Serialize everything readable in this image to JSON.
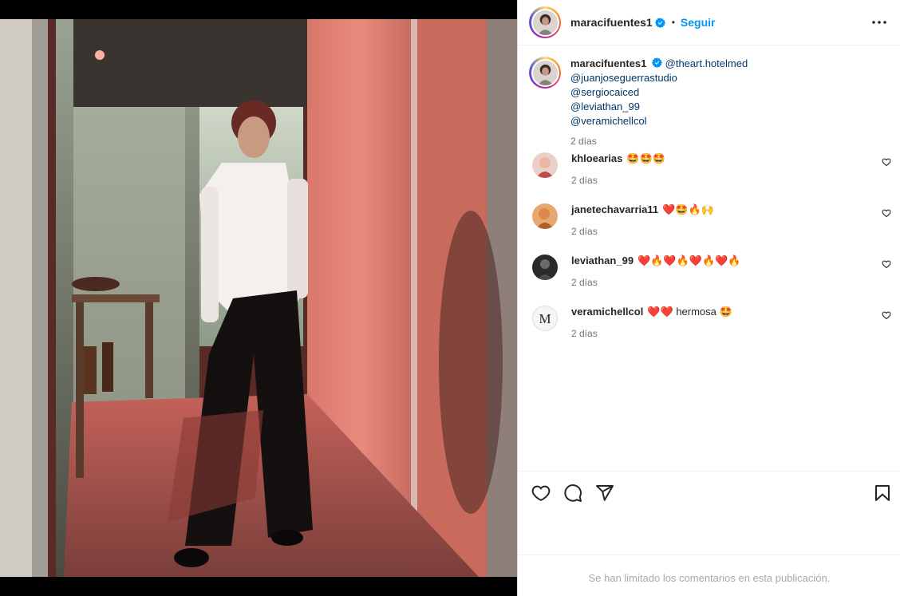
{
  "post": {
    "author": "maracifuentes1",
    "verified": true,
    "separator": "•",
    "follow_label": "Seguir",
    "more_icon": "more-horizontal-icon"
  },
  "caption": {
    "author": "maracifuentes1",
    "mentions": [
      "@theart.hotelmed",
      "@juanjoseguerrastudio",
      "@sergiocaiced",
      "@leviathan_99",
      "@veramichellcol"
    ],
    "age": "2 días"
  },
  "comments": [
    {
      "user": "khloearias",
      "text": "🤩🤩🤩",
      "age": "2 días",
      "avatar_color": "#e8c6c0"
    },
    {
      "user": "janetechavarria11",
      "text": "❤️🤩🔥🙌",
      "age": "2 días",
      "avatar_color": "#d89a5c"
    },
    {
      "user": "leviathan_99",
      "text": "❤️🔥❤️🔥❤️🔥❤️🔥",
      "age": "2 días",
      "avatar_color": "#2b2b2b"
    },
    {
      "user": "veramichellcol",
      "text": "❤️❤️ hermosa 🤩",
      "age": "2 días",
      "avatar_color": "#f4f4f4",
      "avatar_letter": "M"
    }
  ],
  "actions": {
    "like_icon": "heart-icon",
    "comment_icon": "comment-icon",
    "share_icon": "send-icon",
    "save_icon": "bookmark-icon"
  },
  "footer": {
    "limited_text": "Se han limitado los comentarios en esta publicación."
  },
  "colors": {
    "link": "#0095f6",
    "mention": "#00376b",
    "verified": "#0095f6",
    "secondary_text": "#737373"
  }
}
